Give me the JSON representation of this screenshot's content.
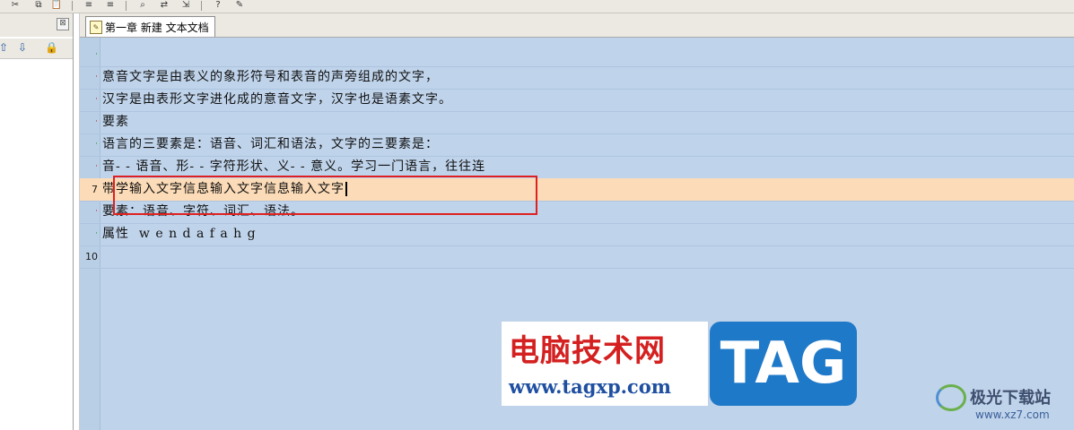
{
  "toolbar": {
    "icons": [
      "scissors-icon",
      "copy-icon",
      "paste-icon",
      "indent-icon",
      "outdent-icon",
      "find-icon",
      "replace-icon",
      "find-next-icon",
      "help-icon",
      "notes-icon"
    ]
  },
  "left_panel": {
    "close_glyph": "⊠",
    "tools": {
      "up": "⇧",
      "down": "⇩",
      "lock": "🔒"
    }
  },
  "tab": {
    "label": "第一章 新建 文本文档",
    "icon": "document-edit-icon"
  },
  "editor": {
    "lines": [
      {
        "marker": "·",
        "marker_color": "green",
        "text": ""
      },
      {
        "marker": "·",
        "marker_color": "red",
        "text": "意音文字是由表义的象形符号和表音的声旁组成的文字，"
      },
      {
        "marker": "·",
        "marker_color": "red",
        "text": "汉字是由表形文字进化成的意音文字，汉字也是语素文字。"
      },
      {
        "marker": "·",
        "marker_color": "red",
        "text": "要素"
      },
      {
        "marker": "·",
        "marker_color": "green",
        "text": "语言的三要素是：语音、词汇和语法，文字的三要素是："
      },
      {
        "marker": "·",
        "marker_color": "red",
        "text": "音- - 语音、形- - 字符形状、义- - 意义。学习一门语言，往往连"
      },
      {
        "marker": "7",
        "marker_color": "black",
        "text": "带学输入文字信息输入文字信息输入文字"
      },
      {
        "marker": "·",
        "marker_color": "red",
        "text": "要素：语音、字符、词汇、语法。"
      },
      {
        "marker": "·",
        "marker_color": "green",
        "text": "属性  w e n d a f a h g"
      },
      {
        "marker": "10",
        "marker_color": "black",
        "text": ""
      }
    ],
    "current_line_index": 6,
    "selection_color": "#e02020"
  },
  "watermarks": {
    "site_title": "电脑技术网",
    "site_url": "www.tagxp.com",
    "tag_text": "TAG",
    "brand_name": "极光下载站",
    "brand_url": "www.xz7.com"
  },
  "colors": {
    "editor_bg": "#bfd3ea",
    "current_line": "#fcdcb8",
    "highlight_border": "#e02020",
    "tag_bg": "#1f79c9"
  }
}
